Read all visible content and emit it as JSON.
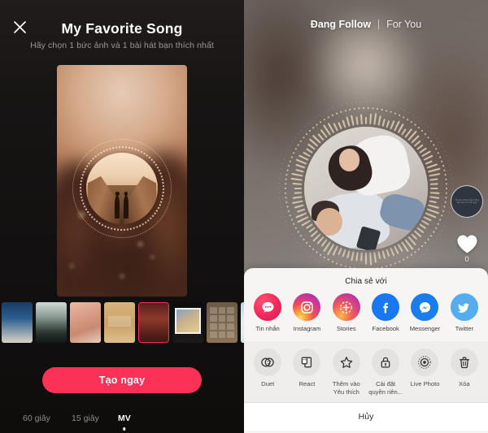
{
  "left": {
    "close_icon": "close-icon",
    "title": "My Favorite Song",
    "subtitle": "Hãy chọn 1 bức ảnh và 1 bài hát bạn thích nhất",
    "cta_label": "Tạo ngay",
    "thumbnails": [
      {
        "name": "thumb-0",
        "selected": false
      },
      {
        "name": "thumb-1",
        "selected": false
      },
      {
        "name": "thumb-2",
        "selected": false
      },
      {
        "name": "thumb-3",
        "selected": false
      },
      {
        "name": "thumb-4",
        "selected": true
      },
      {
        "name": "thumb-5",
        "selected": false
      },
      {
        "name": "thumb-6",
        "selected": false
      },
      {
        "name": "thumb-7",
        "selected": false
      },
      {
        "name": "thumb-8",
        "selected": false
      }
    ],
    "modes": [
      {
        "label": "60 giây",
        "active": false
      },
      {
        "label": "15 giây",
        "active": false
      },
      {
        "label": "MV",
        "active": true
      }
    ]
  },
  "right": {
    "tabs": [
      {
        "label": "Đang Follow",
        "active": true
      },
      {
        "label": "For You",
        "active": false
      }
    ],
    "avatar_text": "Tôi yêu những ngày nắng đẹp bên em mỗi ngày",
    "like_icon": "heart-icon",
    "like_count": "0"
  },
  "share_sheet": {
    "title": "Chia sẻ với",
    "apps": [
      {
        "label": "Tin nhắn",
        "icon": "message-bubble-icon",
        "color": "#f1275b"
      },
      {
        "label": "Instagram",
        "icon": "instagram-icon",
        "color": "#cd3699"
      },
      {
        "label": "Stories",
        "icon": "instagram-stories-icon",
        "color": "#9336b4"
      },
      {
        "label": "Facebook",
        "icon": "facebook-icon",
        "color": "#1877f2"
      },
      {
        "label": "Messenger",
        "icon": "messenger-icon",
        "color": "#1b7ded"
      },
      {
        "label": "Twitter",
        "icon": "twitter-bird-icon",
        "color": "#55acee"
      }
    ],
    "actions": [
      {
        "label": "Duet",
        "icon": "duet-icon"
      },
      {
        "label": "React",
        "icon": "react-icon"
      },
      {
        "label": "Thêm vào Yêu thích",
        "icon": "star-icon"
      },
      {
        "label": "Cài đặt quyền riên...",
        "icon": "lock-icon"
      },
      {
        "label": "Live Photo",
        "icon": "live-photo-icon"
      },
      {
        "label": "Xóa",
        "icon": "trash-icon"
      }
    ],
    "cancel_label": "Hủy"
  }
}
